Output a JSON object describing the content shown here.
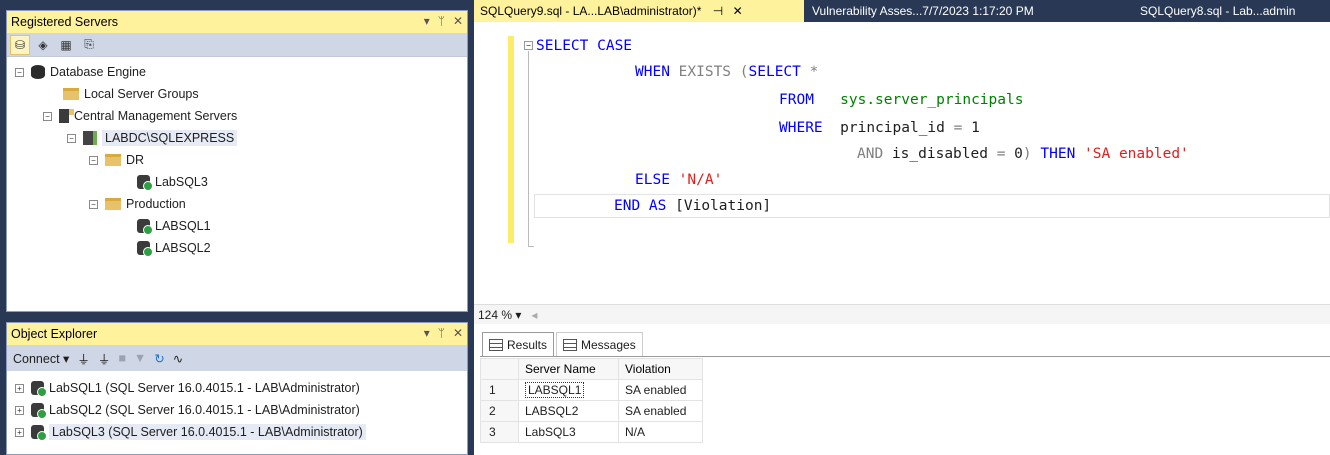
{
  "registered_servers": {
    "title": "Registered Servers",
    "toolbar": [
      "database-engine-icon",
      "analysis-services-icon",
      "reporting-services-icon",
      "integration-services-icon"
    ],
    "tree": [
      {
        "label": "Database Engine",
        "icon": "database-icon",
        "expander": "⊟"
      },
      {
        "label": "Local Server Groups",
        "icon": "folder-icon"
      },
      {
        "label": "Central Management Servers",
        "icon": "cms-icon",
        "expander": "⊟"
      },
      {
        "label": "LABDC\\SQLEXPRESS",
        "icon": "server-group-icon",
        "expander": "⊟"
      },
      {
        "label": "DR",
        "icon": "folder-icon",
        "expander": "⊟"
      },
      {
        "label": "LabSQL3",
        "icon": "server-icon"
      },
      {
        "label": "Production",
        "icon": "folder-icon",
        "expander": "⊟"
      },
      {
        "label": "LABSQL1",
        "icon": "server-icon"
      },
      {
        "label": "LABSQL2",
        "icon": "server-icon"
      }
    ]
  },
  "object_explorer": {
    "title": "Object Explorer",
    "connect_label": "Connect",
    "servers": [
      {
        "label": "LabSQL1 (SQL Server 16.0.4015.1 - LAB\\Administrator)"
      },
      {
        "label": "LabSQL2 (SQL Server 16.0.4015.1 - LAB\\Administrator)"
      },
      {
        "label": "LabSQL3 (SQL Server 16.0.4015.1 - LAB\\Administrator)"
      }
    ]
  },
  "tabs": [
    {
      "label": "SQLQuery9.sql - LA...LAB\\administrator)*",
      "active": true
    },
    {
      "label": "Vulnerability Asses...7/7/2023 1:17:20 PM",
      "active": false
    },
    {
      "label": "SQLQuery8.sql - Lab...admin",
      "active": false
    }
  ],
  "editor": {
    "l1_kw": "SELECT CASE",
    "l2_kw": "WHEN",
    "l2_op": "EXISTS",
    "l2_p": "(",
    "l2_kw2": "SELECT",
    "l2_op2": "*",
    "l3_kw": "FROM",
    "l3_sys": "sys.server_principals",
    "l4_kw": "WHERE",
    "l4_text": "principal_id",
    "l4_op": "=",
    "l4_num": "1",
    "l5_op": "AND",
    "l5_text": "is_disabled",
    "l5_op2": "=",
    "l5_num": "0",
    "l5_p": ")",
    "l5_kw": "THEN",
    "l5_str": "'SA enabled'",
    "l6_kw": "ELSE",
    "l6_str": "'N/A'",
    "l7_kw": "END AS",
    "l7_text": "[Violation]"
  },
  "zoom": "124 %",
  "results": {
    "tabs": [
      "Results",
      "Messages"
    ],
    "columns": [
      "Server Name",
      "Violation"
    ],
    "rows": [
      {
        "n": "1",
        "server": "LABSQL1",
        "violation": "SA enabled"
      },
      {
        "n": "2",
        "server": "LABSQL2",
        "violation": "SA enabled"
      },
      {
        "n": "3",
        "server": "LabSQL3",
        "violation": "N/A"
      }
    ]
  }
}
